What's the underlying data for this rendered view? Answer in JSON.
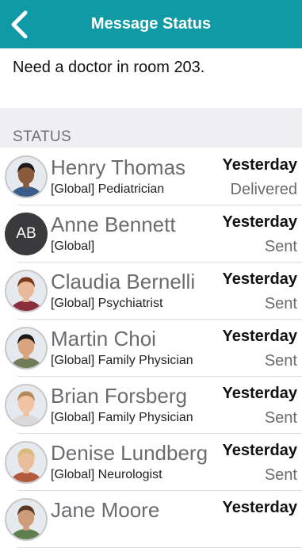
{
  "header": {
    "title": "Message Status"
  },
  "message": {
    "text": "Need a doctor in room 203."
  },
  "section_label": "STATUS",
  "recipients": [
    {
      "name": "Henry Thomas",
      "role": "[Global] Pediatrician",
      "when": "Yesterday",
      "status": "Delivered",
      "avatar": "photo",
      "skin": "#8a5a3c",
      "hair": "#1b1b1b",
      "shirt": "#3a5d8c"
    },
    {
      "name": "Anne Bennett",
      "role": "[Global]",
      "when": "Yesterday",
      "status": "Sent",
      "avatar": "initials",
      "initials": "AB"
    },
    {
      "name": "Claudia Bernelli",
      "role": "[Global] Psychiatrist",
      "when": "Yesterday",
      "status": "Sent",
      "avatar": "photo",
      "skin": "#e8b99a",
      "hair": "#7a3a1e",
      "shirt": "#8b2d3b"
    },
    {
      "name": "Martin Choi",
      "role": "[Global] Family Physician",
      "when": "Yesterday",
      "status": "Sent",
      "avatar": "photo",
      "skin": "#d9a47e",
      "hair": "#1f1a17",
      "shirt": "#6f7c57"
    },
    {
      "name": "Brian Forsberg",
      "role": "[Global] Family Physician",
      "when": "Yesterday",
      "status": "Sent",
      "avatar": "photo",
      "skin": "#f0c3a3",
      "hair": "#b28a5c",
      "shirt": "#d9d9d9"
    },
    {
      "name": "Denise Lundberg",
      "role": "[Global] Neurologist",
      "when": "Yesterday",
      "status": "Sent",
      "avatar": "photo",
      "skin": "#e9be9a",
      "hair": "#d8bb7a",
      "shirt": "#b45a3c"
    },
    {
      "name": "Jane Moore",
      "role": "",
      "when": "Yesterday",
      "status": "",
      "avatar": "photo",
      "skin": "#cf9c7a",
      "hair": "#5a3a24",
      "shirt": "#5f7f4f"
    }
  ]
}
